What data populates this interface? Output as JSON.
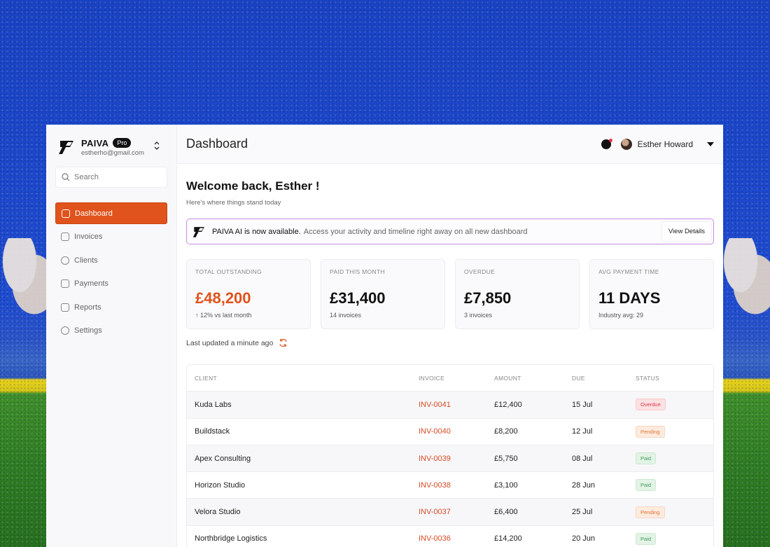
{
  "brand": {
    "name": "PAIVA",
    "plan": "Pro",
    "email": "estherho@gmail.com"
  },
  "search": {
    "placeholder": "Search"
  },
  "nav": [
    {
      "label": "Dashboard",
      "icon": "dashboard-icon",
      "active": true
    },
    {
      "label": "Invoices",
      "icon": "invoice-icon"
    },
    {
      "label": "Clients",
      "icon": "users-icon"
    },
    {
      "label": "Payments",
      "icon": "wallet-icon"
    },
    {
      "label": "Reports",
      "icon": "report-icon"
    },
    {
      "label": "Settings",
      "icon": "gear-icon"
    }
  ],
  "header": {
    "title": "Dashboard",
    "user_name": "Esther Howard"
  },
  "welcome": {
    "title": "Welcome back, Esther !",
    "subtitle": "Here's where things stand today"
  },
  "banner": {
    "title": "PAIVA AI is now available.",
    "description": "Access your activity and timeline right away on all new dashboard",
    "button": "View Details"
  },
  "cards": [
    {
      "label": "TOTAL OUTSTANDING",
      "value": "£48,200",
      "sub": "↑ 12% vs last month"
    },
    {
      "label": "PAID THIS MONTH",
      "value": "£31,400",
      "sub": "14 invoices"
    },
    {
      "label": "OVERDUE",
      "value": "£7,850",
      "sub": "3 invoices"
    },
    {
      "label": "AVG PAYMENT TIME",
      "value": "11 DAYS",
      "sub": "Industry avg: 29"
    }
  ],
  "updated": "Last updated a minute ago",
  "table": {
    "columns": [
      "CLIENT",
      "INVOICE",
      "AMOUNT",
      "DUE",
      "STATUS"
    ],
    "rows": [
      {
        "client": "Kuda Labs",
        "invoice": "INV-0041",
        "amount": "£12,400",
        "due": "15 Jul",
        "status": "Overdue"
      },
      {
        "client": "Buildstack",
        "invoice": "INV-0040",
        "amount": "£8,200",
        "due": "12 Jul",
        "status": "Pending"
      },
      {
        "client": "Apex Consulting",
        "invoice": "INV-0039",
        "amount": "£5,750",
        "due": "08 Jul",
        "status": "Paid"
      },
      {
        "client": "Horizon Studio",
        "invoice": "INV-0038",
        "amount": "£3,100",
        "due": "28 Jun",
        "status": "Paid"
      },
      {
        "client": "Velora Studio",
        "invoice": "INV-0037",
        "amount": "£6,400",
        "due": "25 Jul",
        "status": "Pending"
      },
      {
        "client": "Northbridge Logistics",
        "invoice": "INV-0036",
        "amount": "£14,200",
        "due": "20 Jun",
        "status": "Paid"
      }
    ]
  },
  "colors": {
    "accent": "#e0531c",
    "invoice": "#d84a25",
    "banner_border": "#c98de0"
  }
}
